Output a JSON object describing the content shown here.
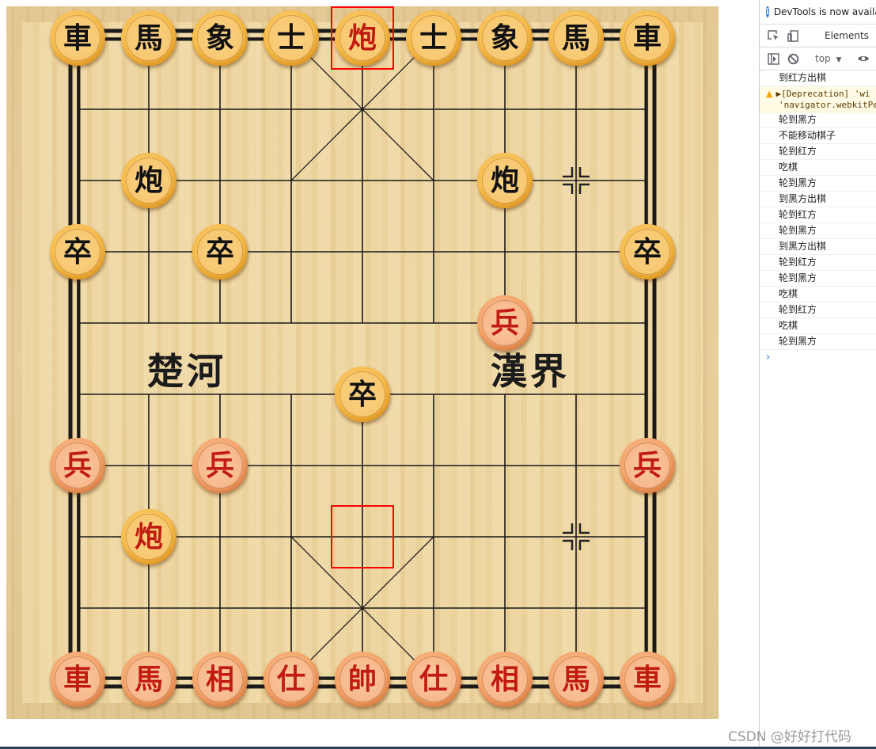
{
  "board": {
    "river_left": "楚河",
    "river_right": "漢界",
    "pieces": [
      {
        "label": "車",
        "side": "black",
        "face": "yellow",
        "ink": "black",
        "col": 0,
        "row": 0
      },
      {
        "label": "馬",
        "side": "black",
        "face": "yellow",
        "ink": "black",
        "col": 1,
        "row": 0
      },
      {
        "label": "象",
        "side": "black",
        "face": "yellow",
        "ink": "black",
        "col": 2,
        "row": 0
      },
      {
        "label": "士",
        "side": "black",
        "face": "yellow",
        "ink": "black",
        "col": 3,
        "row": 0
      },
      {
        "label": "炮",
        "side": "red",
        "face": "yellow",
        "ink": "red",
        "col": 4,
        "row": 0
      },
      {
        "label": "士",
        "side": "black",
        "face": "yellow",
        "ink": "black",
        "col": 5,
        "row": 0
      },
      {
        "label": "象",
        "side": "black",
        "face": "yellow",
        "ink": "black",
        "col": 6,
        "row": 0
      },
      {
        "label": "馬",
        "side": "black",
        "face": "yellow",
        "ink": "black",
        "col": 7,
        "row": 0
      },
      {
        "label": "車",
        "side": "black",
        "face": "yellow",
        "ink": "black",
        "col": 8,
        "row": 0
      },
      {
        "label": "炮",
        "side": "black",
        "face": "yellow",
        "ink": "black",
        "col": 1,
        "row": 2
      },
      {
        "label": "炮",
        "side": "black",
        "face": "yellow",
        "ink": "black",
        "col": 6,
        "row": 2
      },
      {
        "label": "卒",
        "side": "black",
        "face": "yellow",
        "ink": "black",
        "col": 0,
        "row": 3
      },
      {
        "label": "卒",
        "side": "black",
        "face": "yellow",
        "ink": "black",
        "col": 2,
        "row": 3
      },
      {
        "label": "卒",
        "side": "black",
        "face": "yellow",
        "ink": "black",
        "col": 8,
        "row": 3
      },
      {
        "label": "兵",
        "side": "red",
        "face": "orange",
        "ink": "red",
        "col": 6,
        "row": 4
      },
      {
        "label": "卒",
        "side": "black",
        "face": "yellow",
        "ink": "black",
        "col": 4,
        "row": 5
      },
      {
        "label": "兵",
        "side": "red",
        "face": "orange",
        "ink": "red",
        "col": 0,
        "row": 6
      },
      {
        "label": "兵",
        "side": "red",
        "face": "orange",
        "ink": "red",
        "col": 2,
        "row": 6
      },
      {
        "label": "兵",
        "side": "red",
        "face": "orange",
        "ink": "red",
        "col": 8,
        "row": 6
      },
      {
        "label": "炮",
        "side": "red",
        "face": "yellow",
        "ink": "red",
        "col": 1,
        "row": 7
      },
      {
        "label": "車",
        "side": "red",
        "face": "orange",
        "ink": "red",
        "col": 0,
        "row": 9
      },
      {
        "label": "馬",
        "side": "red",
        "face": "orange",
        "ink": "red",
        "col": 1,
        "row": 9
      },
      {
        "label": "相",
        "side": "red",
        "face": "orange",
        "ink": "red",
        "col": 2,
        "row": 9
      },
      {
        "label": "仕",
        "side": "red",
        "face": "orange",
        "ink": "red",
        "col": 3,
        "row": 9
      },
      {
        "label": "帥",
        "side": "red",
        "face": "orange",
        "ink": "red",
        "col": 4,
        "row": 9
      },
      {
        "label": "仕",
        "side": "red",
        "face": "orange",
        "ink": "red",
        "col": 5,
        "row": 9
      },
      {
        "label": "相",
        "side": "red",
        "face": "orange",
        "ink": "red",
        "col": 6,
        "row": 9
      },
      {
        "label": "馬",
        "side": "red",
        "face": "orange",
        "ink": "red",
        "col": 7,
        "row": 9
      },
      {
        "label": "車",
        "side": "red",
        "face": "orange",
        "ink": "red",
        "col": 8,
        "row": 9
      }
    ],
    "move_markers": [
      {
        "col": 4,
        "row": 0,
        "kind": "move-to"
      },
      {
        "col": 4,
        "row": 7,
        "kind": "move-from"
      }
    ],
    "position_marks": [
      {
        "col": 7,
        "row": 2
      },
      {
        "col": 7,
        "row": 7
      }
    ],
    "colors": {
      "selection": "#ff0000",
      "red_ink": "#c21c10",
      "black_ink": "#111111"
    }
  },
  "devtools": {
    "banner": "DevTools is now availa",
    "tabs": [
      "Elements"
    ],
    "context": "top",
    "log": [
      {
        "type": "log",
        "text": "到红方出棋"
      },
      {
        "type": "warn",
        "text": "▶[Deprecation] 'wi",
        "text2": "'navigator.webkitPe"
      },
      {
        "type": "log",
        "text": "轮到黑方"
      },
      {
        "type": "log",
        "text": "不能移动棋子"
      },
      {
        "type": "log",
        "text": "轮到红方"
      },
      {
        "type": "log",
        "text": "吃棋"
      },
      {
        "type": "log",
        "text": "轮到黑方"
      },
      {
        "type": "log",
        "text": "到黑方出棋"
      },
      {
        "type": "log",
        "text": "轮到红方"
      },
      {
        "type": "log",
        "text": "轮到黑方"
      },
      {
        "type": "log",
        "text": "到黑方出棋"
      },
      {
        "type": "log",
        "text": "轮到红方"
      },
      {
        "type": "log",
        "text": "轮到黑方"
      },
      {
        "type": "log",
        "text": "吃棋"
      },
      {
        "type": "log",
        "text": "轮到红方"
      },
      {
        "type": "log",
        "text": "吃棋"
      },
      {
        "type": "log",
        "text": "轮到黑方"
      }
    ],
    "prompt": "›"
  },
  "watermark": "CSDN @好好打代码"
}
